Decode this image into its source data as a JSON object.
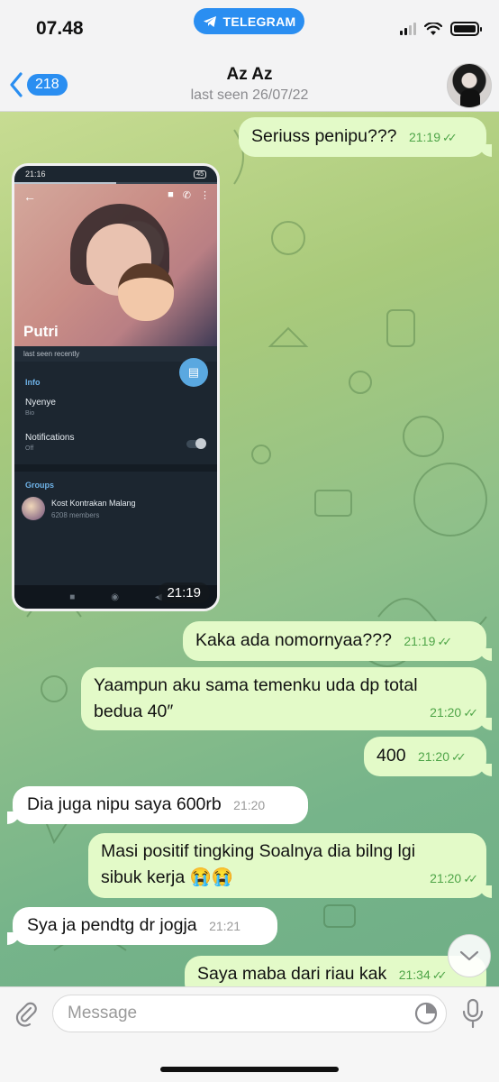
{
  "status_bar": {
    "time": "07.48",
    "app_pill": "TELEGRAM"
  },
  "header": {
    "back_count": "218",
    "title": "Az Az",
    "subtitle": "last seen 26/07/22"
  },
  "messages": [
    {
      "dir": "out",
      "text": "Seriuss penipu???",
      "time": "21:19",
      "read": true
    },
    {
      "dir": "out",
      "type": "photo",
      "time": "21:19"
    },
    {
      "dir": "out",
      "text": "Kaka ada nomornyaa???",
      "time": "21:19",
      "read": true
    },
    {
      "dir": "out",
      "text_line1": "Yaampun aku sama temenku uda dp total",
      "text_line2": "bedua 40″",
      "time": "21:20",
      "read": true
    },
    {
      "dir": "out",
      "text": "400",
      "time": "21:20",
      "read": true
    },
    {
      "dir": "in",
      "text": "Dia juga nipu saya 600rb",
      "time": "21:20"
    },
    {
      "dir": "out",
      "text_line1": "Masi positif tingking Soalnya dia bilng lgi",
      "text_line2": "sibuk kerja 😭😭",
      "time": "21:20",
      "read": true
    },
    {
      "dir": "in",
      "text": "Sya ja pendtg dr jogja",
      "time": "21:21"
    },
    {
      "dir": "out",
      "text": "Saya maba dari riau kak",
      "time": "21:34",
      "read": true
    }
  ],
  "photo_screenshot": {
    "status_time": "21:16",
    "status_battery": "45",
    "name": "Putri",
    "seen": "last seen recently",
    "info_header": "Info",
    "bio_value": "Nyenye",
    "bio_label": "Bio",
    "notif_value": "Notifications",
    "notif_label": "Off",
    "groups_header": "Groups",
    "group_name": "Kost Kontrakan Malang",
    "group_members": "6208 members"
  },
  "input": {
    "placeholder": "Message"
  },
  "colors": {
    "accent": "#2a8ef1",
    "outgoing_bubble": "#e3fac8",
    "incoming_bubble": "#ffffff",
    "read_tick": "#4fa548"
  },
  "icons": [
    "telegram-icon",
    "signal-icon",
    "wifi-icon",
    "battery-icon",
    "back-chevron-icon",
    "attach-icon",
    "sticker-icon",
    "mic-icon",
    "scroll-down-icon"
  ]
}
